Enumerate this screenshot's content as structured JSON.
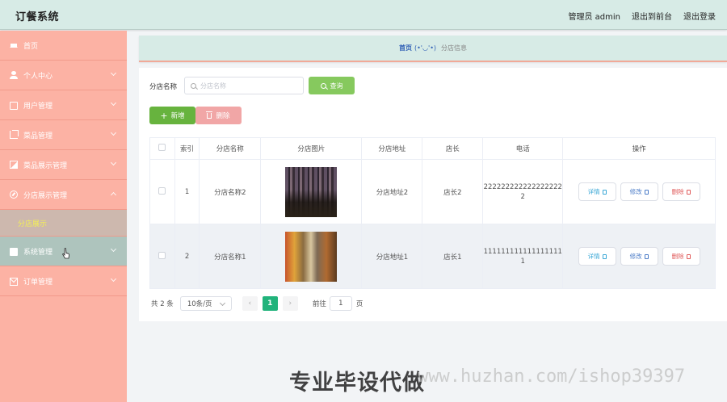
{
  "header": {
    "app_title": "订餐系统",
    "user": "管理员 admin",
    "to_front": "退出到前台",
    "logout": "退出登录"
  },
  "sidebar": {
    "items": [
      {
        "label": "首页",
        "icon": "home-icon",
        "expandable": false
      },
      {
        "label": "个人中心",
        "icon": "user-icon",
        "expandable": true
      },
      {
        "label": "用户管理",
        "icon": "id-card-icon",
        "expandable": true
      },
      {
        "label": "菜品管理",
        "icon": "crop-icon",
        "expandable": true
      },
      {
        "label": "菜品展示管理",
        "icon": "picture-icon",
        "expandable": true
      },
      {
        "label": "分店展示管理",
        "icon": "compass-icon",
        "expandable": true,
        "expanded": true
      },
      {
        "label": "系统管理",
        "icon": "chat-icon",
        "expandable": true,
        "hovered": true
      },
      {
        "label": "订单管理",
        "icon": "mail-icon",
        "expandable": true
      }
    ],
    "submenu": [
      "分店展示"
    ]
  },
  "breadcrumb": {
    "home": "首页",
    "face": "(•'◡'•)",
    "current": "分店信息"
  },
  "search": {
    "label": "分店名称",
    "placeholder": "分店名称",
    "query_button": "查询"
  },
  "actions": {
    "add_button": "新增",
    "delete_button": "删除"
  },
  "table": {
    "columns": [
      "索引",
      "分店名称",
      "分店图片",
      "分店地址",
      "店长",
      "电话",
      "操作"
    ],
    "rows": [
      {
        "index": "1",
        "name": "分店名称2",
        "address": "分店地址2",
        "manager": "店长2",
        "phone": "2222222222222222222"
      },
      {
        "index": "2",
        "name": "分店名称1",
        "address": "分店地址1",
        "manager": "店长1",
        "phone": "1111111111111111111"
      }
    ],
    "op_detail": "详情",
    "op_edit": "修改",
    "op_delete": "删除"
  },
  "pagination": {
    "total": "共 2 条",
    "page_size": "10条/页",
    "current_page": "1",
    "jump_label": "前往",
    "jump_value": "1",
    "page_suffix": "页"
  },
  "watermark": {
    "text": "专业毕设代做",
    "url": "www.huzhan.com/ishop39397"
  },
  "colors": {
    "topbar": "#d7ebe6",
    "sidebar": "#fcb2a4",
    "submenu_text": "#f3ee57",
    "query_button": "#86c95e",
    "add_button": "#67b33e",
    "delete_button": "#f1a6a6",
    "active_page": "#21b37b"
  }
}
